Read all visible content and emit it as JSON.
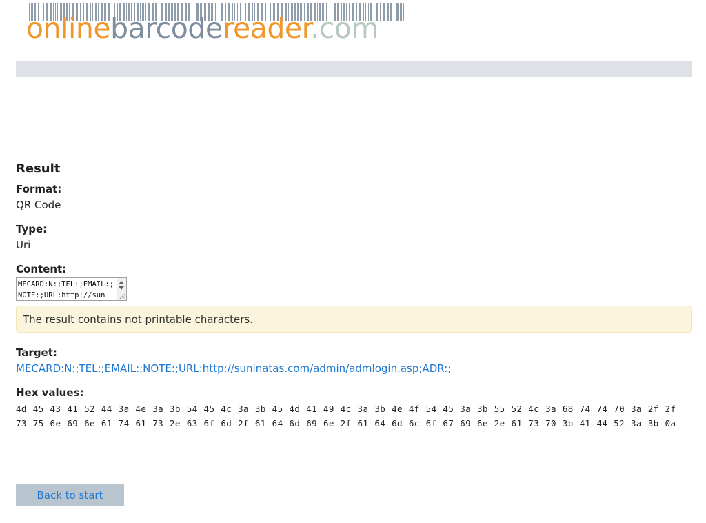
{
  "logo": {
    "part1": "online",
    "part2": "barcode",
    "part3": "reader",
    "part4": ".com"
  },
  "colors": {
    "logo_orange": "#f0962a",
    "logo_gray": "#7f8e9e",
    "logo_green": "#b6c8c0",
    "nav_bar": "#dee2e6",
    "alert_bg": "#fcf5dd",
    "link": "#1f78d1",
    "button_bg": "#b8c5cf"
  },
  "result": {
    "heading": "Result",
    "format_label": "Format:",
    "format_value": "QR Code",
    "type_label": "Type:",
    "type_value": "Uri",
    "content_label": "Content:",
    "content_value": "MECARD:N:;TEL:;EMAIL:;NOTE:;URL:http://sun",
    "alert_text": "The result contains not printable characters.",
    "target_label": "Target:",
    "target_link": "MECARD:N:;TEL:;EMAIL:;NOTE:;URL:http://suninatas.com/admin/admlogin.asp;ADR:;",
    "hex_label": "Hex values:",
    "hex_values": "4d 45 43 41 52 44 3a 4e 3a 3b 54 45 4c 3a 3b 45 4d 41 49 4c 3a 3b 4e 4f 54 45 3a 3b 55 52 4c 3a 68 74 74 70 3a 2f 2f 73 75 6e 69 6e 61 74 61 73 2e 63 6f 6d 2f 61 64 6d 69 6e 2f 61 64 6d 6c 6f 67 69 6e 2e 61 73 70 3b 41 44 52 3a 3b 0a"
  },
  "actions": {
    "back_label": "Back to start"
  }
}
